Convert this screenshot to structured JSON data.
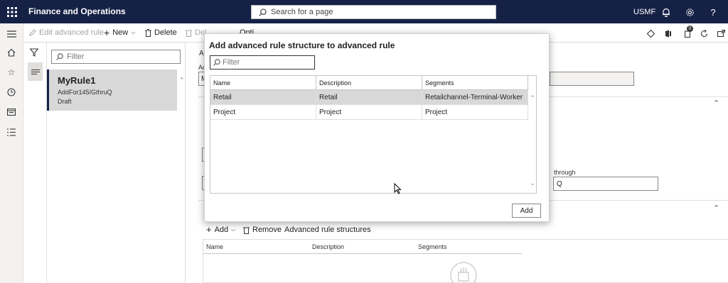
{
  "topbar": {
    "app_title": "Finance and Operations",
    "search_placeholder": "Search for a page",
    "company": "USMF",
    "icons": [
      "waffle-icon",
      "bell-icon",
      "gear-icon",
      "help-icon"
    ]
  },
  "navpane": {
    "icons": [
      "hamburger-icon",
      "home-icon",
      "star-icon",
      "clock-icon",
      "workspace-icon",
      "modules-icon"
    ]
  },
  "actionbar": {
    "edit_label": "Edit advanced rule",
    "new_label": "New",
    "delete_label": "Delete",
    "truncated_1": "Del",
    "truncated_2": "Opti",
    "notification_count": "0"
  },
  "listpane": {
    "filter_placeholder": "Filter",
    "card": {
      "title": "MyRule1",
      "subtitle": "AddFor145/GthruQ",
      "status": "Draft"
    }
  },
  "content": {
    "header_fragment": "Ac",
    "field_fragment": "Ac",
    "input_fragment": "M",
    "through_label": "through",
    "through_value": "Q",
    "grid_toolbar": {
      "add_label": "Add",
      "remove_label": "Remove",
      "structures_label": "Advanced rule structures"
    },
    "grid_columns": [
      "Name",
      "Description",
      "Segments"
    ]
  },
  "dialog": {
    "title": "Add advanced rule structure to advanced rule",
    "filter_placeholder": "Filter",
    "columns": [
      "Name",
      "Description",
      "Segments"
    ],
    "rows": [
      {
        "name": "Retail",
        "description": "Retail",
        "segments": "Retailchannel-Terminal-Worker"
      },
      {
        "name": "Project",
        "description": "Project",
        "segments": "Project"
      }
    ],
    "selected_row": 0,
    "add_button": "Add"
  }
}
